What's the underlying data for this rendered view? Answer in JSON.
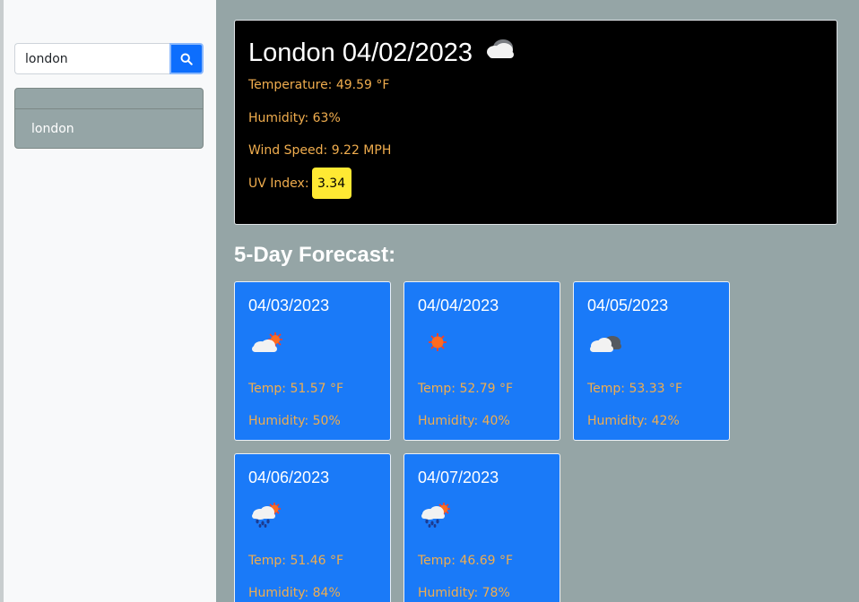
{
  "search": {
    "value": "london",
    "placeholder": ""
  },
  "history": {
    "items": [
      {
        "label": "london"
      }
    ]
  },
  "current": {
    "city_date": "London 04/02/2023",
    "icon": "cloud-icon",
    "temperature": "Temperature: 49.59 °F",
    "humidity": "Humidity: 63%",
    "wind": "Wind Speed: 9.22 MPH",
    "uv_label": "UV Index:",
    "uv_value": "3.34"
  },
  "forecast": {
    "title": "5-Day Forecast:",
    "days": [
      {
        "date": "04/03/2023",
        "icon": "cloud-sun-icon",
        "temp": "Temp: 51.57 °F",
        "humidity": "Humidity: 50%"
      },
      {
        "date": "04/04/2023",
        "icon": "sun-icon",
        "temp": "Temp: 52.79 °F",
        "humidity": "Humidity: 40%"
      },
      {
        "date": "04/05/2023",
        "icon": "clouds-icon",
        "temp": "Temp: 53.33 °F",
        "humidity": "Humidity: 42%"
      },
      {
        "date": "04/06/2023",
        "icon": "rain-sun-icon",
        "temp": "Temp: 51.46 °F",
        "humidity": "Humidity: 84%"
      },
      {
        "date": "04/07/2023",
        "icon": "rain-sun-icon",
        "temp": "Temp: 46.69 °F",
        "humidity": "Humidity: 78%"
      }
    ]
  },
  "colors": {
    "accent": "#0d6efd",
    "card": "#1a7af8",
    "panel": "#95a5a6",
    "stat_text": "#f0ad4e",
    "uv_badge": "#ffe933"
  }
}
